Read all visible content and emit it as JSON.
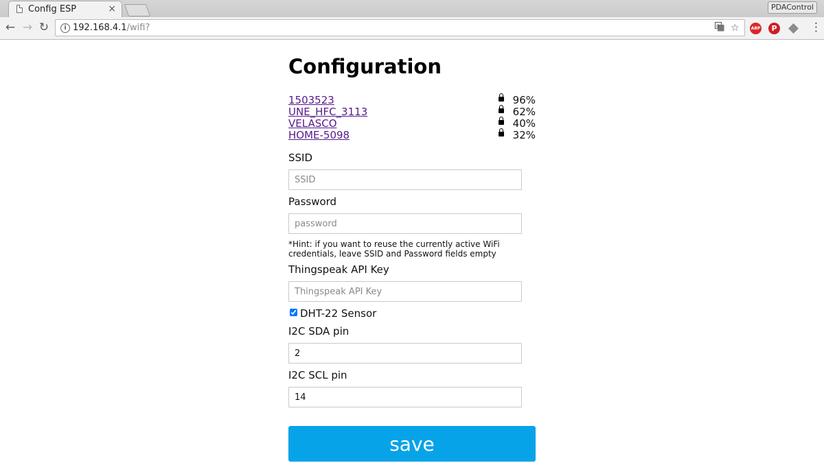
{
  "browser": {
    "tab_title": "Config ESP",
    "tab_close": "×",
    "profile_label": "PDAControl",
    "url_host": "192.168.4.1",
    "url_path": "/wifi?",
    "extensions": [
      {
        "name": "adblock-plus",
        "label": "ABP",
        "color": "#d9282a"
      },
      {
        "name": "pinterest",
        "label": "P",
        "color": "#cb2027"
      }
    ]
  },
  "page": {
    "title": "Configuration",
    "networks": [
      {
        "ssid": "1503523",
        "quality": "96%"
      },
      {
        "ssid": "UNE_HFC_3113",
        "quality": "62%"
      },
      {
        "ssid": "VELASCO",
        "quality": "40%"
      },
      {
        "ssid": "HOME-5098",
        "quality": "32%"
      }
    ],
    "ssid_label": "SSID",
    "ssid_placeholder": "SSID",
    "password_label": "Password",
    "password_placeholder": "password",
    "hint": "*Hint: if you want to reuse the currently active WiFi credentials, leave SSID and Password fields empty",
    "thingspeak_label": "Thingspeak API Key",
    "thingspeak_placeholder": "Thingspeak API Key",
    "dht_label": "DHT-22 Sensor",
    "dht_checked": true,
    "sda_label": "I2C SDA pin",
    "sda_value": "2",
    "scl_label": "I2C SCL pin",
    "scl_value": "14",
    "save_label": "save"
  },
  "colors": {
    "save_button": "#07a3e8",
    "visited_link": "#551a8b"
  }
}
